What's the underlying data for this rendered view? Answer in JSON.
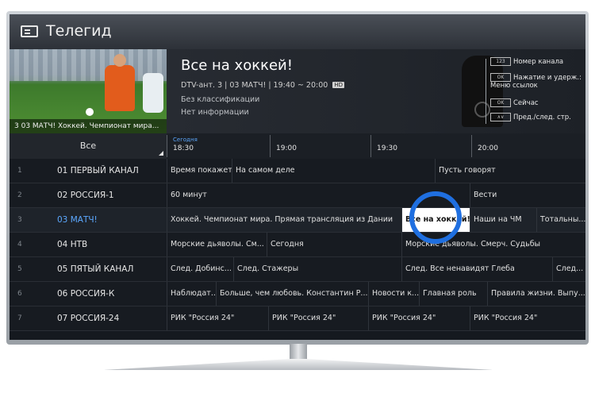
{
  "app": {
    "title": "Телегид"
  },
  "preview": {
    "caption": "3 03 МАТЧ!  Хоккей. Чемпионат мира..."
  },
  "program": {
    "title": "Все на хоккей!",
    "meta": "DTV-ант. 3 | 03 МАТЧ! | 19:40 ~ 20:00",
    "badge": "HD",
    "rating": "Без классификации",
    "info": "Нет информации"
  },
  "legend": [
    {
      "key": "123",
      "label": "Номер канала"
    },
    {
      "key": "OK",
      "label": "Нажатие и удерж.: Меню ссылок"
    },
    {
      "key": "OK",
      "label": "Сейчас"
    },
    {
      "key": "∧∨",
      "label": "Пред./след. стр."
    }
  ],
  "filter": {
    "label": "Все"
  },
  "timeline": {
    "today": "Сегодня",
    "times": [
      "18:30",
      "19:00",
      "19:30",
      "20:00"
    ]
  },
  "channels": [
    {
      "num": "1",
      "name": "01 ПЕРВЫЙ КАНАЛ",
      "programs": [
        "Время покажет",
        "На самом деле",
        "Пусть говорят"
      ]
    },
    {
      "num": "2",
      "name": "02 РОССИЯ-1",
      "programs": [
        "60 минут",
        "Вести"
      ]
    },
    {
      "num": "3",
      "name": "03 МАТЧ!",
      "programs": [
        "Хоккей. Чемпионат мира. Прямая трансляция из Дании",
        "Все на хоккей!",
        "Наши на ЧМ",
        "Тотальны..."
      ]
    },
    {
      "num": "4",
      "name": "04 НТВ",
      "programs": [
        "Морские дьяволы. См...",
        "Сегодня",
        "Морские дьяволы. Смерч. Судьбы"
      ]
    },
    {
      "num": "5",
      "name": "05 ПЯТЫЙ КАНАЛ",
      "programs": [
        "След. Добинс...",
        "След. Стажеры",
        "След. Все ненавидят Глеба",
        "След..."
      ]
    },
    {
      "num": "6",
      "name": "06 РОССИЯ-К",
      "programs": [
        "Наблюдат...",
        "Больше, чем любовь. Константин Р...",
        "Новости к...",
        "Главная роль",
        "Правила жизни. Выпу..."
      ]
    },
    {
      "num": "7",
      "name": "07 РОССИЯ-24",
      "programs": [
        "РИК \"Россия 24\"",
        "РИК \"Россия 24\"",
        "РИК \"Россия 24\"",
        "РИК \"Россия 24\""
      ]
    }
  ],
  "focus": {
    "channel": 3,
    "program": "Все на хоккей!"
  }
}
